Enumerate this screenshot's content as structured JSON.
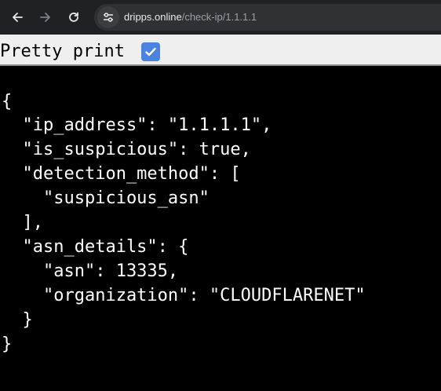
{
  "browser": {
    "url_domain": "dripps.online",
    "url_path": "/check-ip/1.1.1.1"
  },
  "viewer": {
    "pretty_print_label": "Pretty print",
    "pretty_print_checked": true
  },
  "json_lines": [
    "{",
    "  \"ip_address\": \"1.1.1.1\",",
    "  \"is_suspicious\": true,",
    "  \"detection_method\": [",
    "    \"suspicious_asn\"",
    "  ],",
    "  \"asn_details\": {",
    "    \"asn\": 13335,",
    "    \"organization\": \"CLOUDFLARENET\"",
    "  }",
    "}"
  ]
}
